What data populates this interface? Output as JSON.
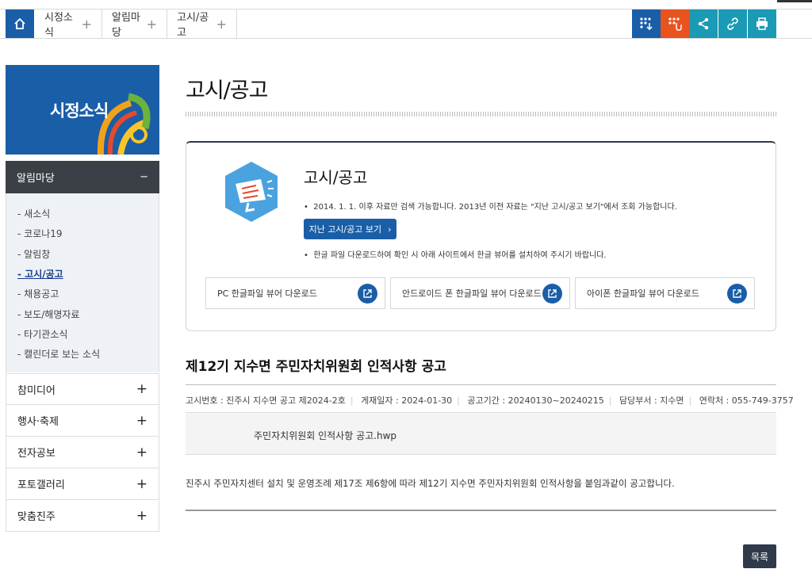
{
  "nav": {
    "crumbs": [
      "시정소식",
      "알림마당",
      "고시/공고"
    ]
  },
  "tools": {
    "colors": [
      "#1a5ea8",
      "#e8531f",
      "#1b9ab5",
      "#1b9ab5",
      "#1b9ab5"
    ],
    "icons": [
      "braille-download-icon",
      "braille-hand-icon",
      "share-icon",
      "link-icon",
      "print-icon"
    ]
  },
  "sidebar": {
    "banner_title": "시정소식",
    "section": "알림마당",
    "section_toggle": "−",
    "items": [
      "새소식",
      "코로나19",
      "알림창",
      "고시/공고",
      "채용공고",
      "보도/해명자료",
      "타기관소식",
      "캘린더로 보는 소식"
    ],
    "active_index": 3,
    "menus": [
      "참미디어",
      "행사·축제",
      "전자공보",
      "포토갤러리",
      "맞춤진주"
    ],
    "menu_toggle": "+"
  },
  "page": {
    "title": "고시/공고"
  },
  "infobox": {
    "title": "고시/공고",
    "note1": "2014. 1. 1. 이후 자료만 검색 가능합니다. 2013년 이전 자료는 \"지난 고시/공고 보기\"에서 조회 가능합니다.",
    "button": "지난 고시/공고 보기",
    "note2": "한글 파일 다운로드하여 확인 시 아래 사이트에서 한글 뷰어를 설치하여 주시기 바랍니다.",
    "downloads": [
      "PC 한글파일 뷰어 다운로드",
      "안드로이드 폰 한글파일 뷰어 다운로드",
      "아이폰 한글파일 뷰어 다운로드"
    ]
  },
  "post": {
    "title": "제12기 지수면 주민자치위원회 인적사항 공고",
    "meta": [
      "고시번호 : 진주시 지수면 공고 제2024-2호",
      "게재일자 : 2024-01-30",
      "공고기간 : 20240130~20240215",
      "담당부서 : 지수면",
      "연락처 : 055-749-3757"
    ],
    "file": "주민자치위원회 인적사항 공고.hwp",
    "body": "진주시 주민자치센터 설치 및 운영조례 제17조 제6항에 따라 제12기 지수면 주민자치위원회 인적사항을 붙임과같이 공고합니다.",
    "list_button": "목록"
  }
}
